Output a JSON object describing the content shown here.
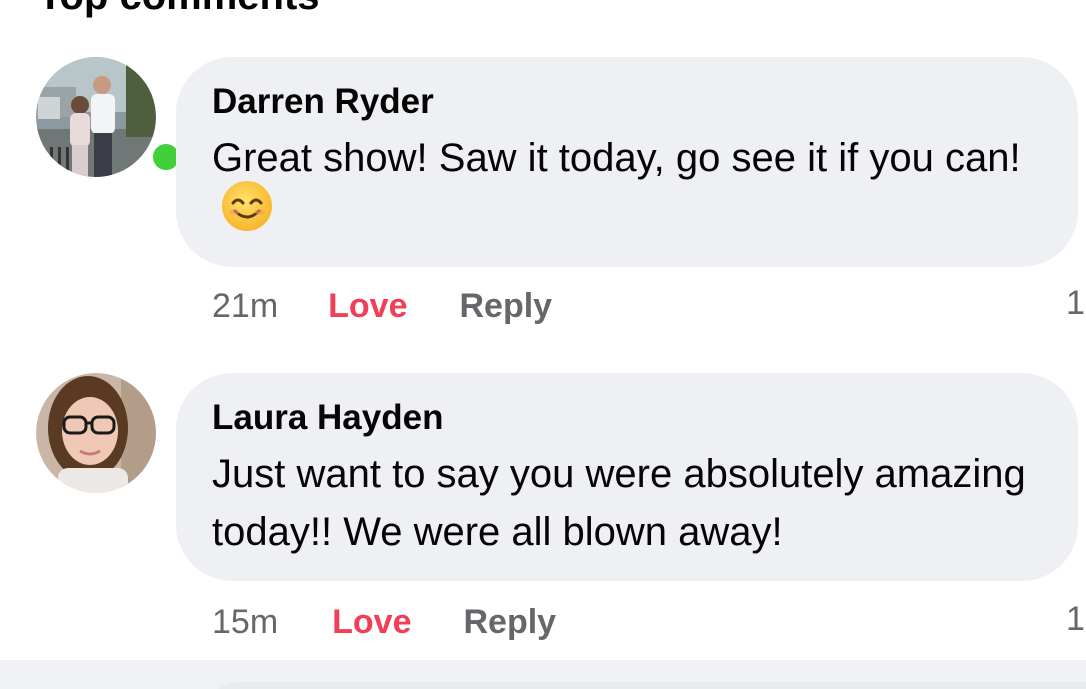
{
  "section": {
    "title": "Top comments"
  },
  "comments": [
    {
      "author": "Darren Ryder",
      "text": "Great show! Saw it today, go see it if you can!",
      "emoji": "smiling-face-emoji",
      "time": "21m",
      "reaction_label": "Love",
      "reply_label": "Reply",
      "reaction_count": "1",
      "online": true
    },
    {
      "author": "Laura Hayden",
      "text": "Just want to say you were absolutely amazing today!! We were all blown away!",
      "time": "15m",
      "reaction_label": "Love",
      "reply_label": "Reply",
      "reaction_count": "1",
      "online": false
    }
  ],
  "colors": {
    "bubble": "#eff0f4",
    "love": "#f33e58",
    "meta": "#65676b",
    "online": "#42d03a"
  }
}
